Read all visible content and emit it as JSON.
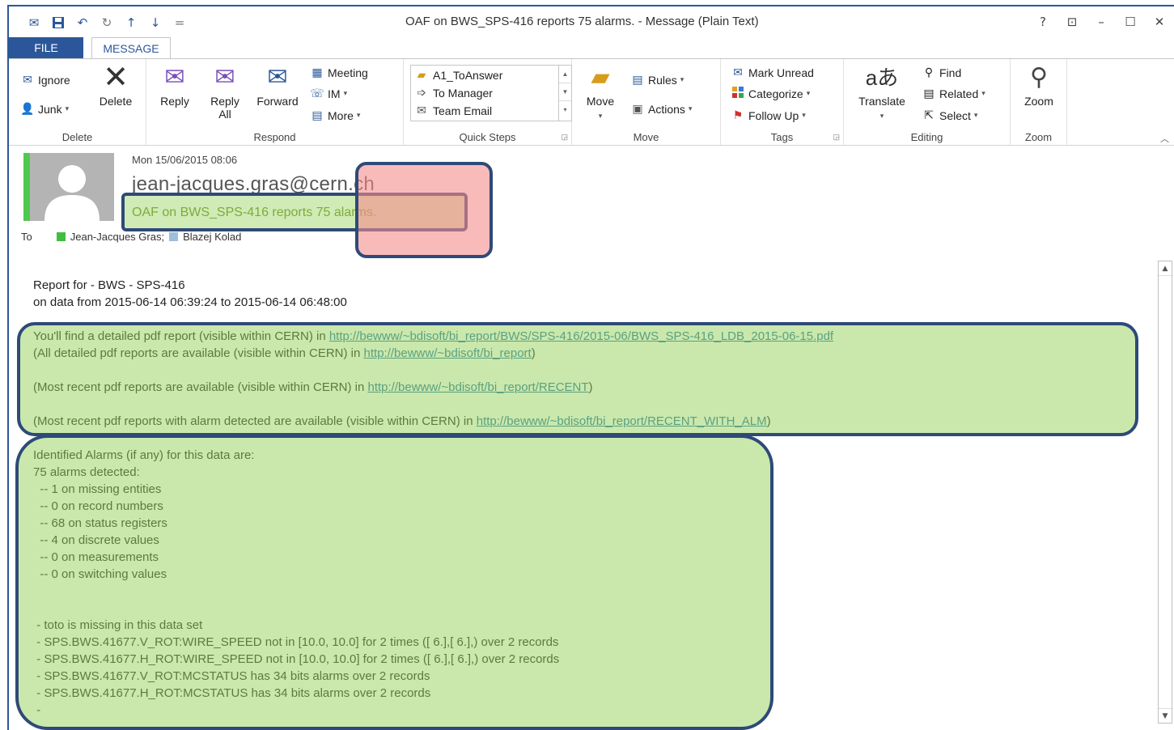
{
  "window": {
    "title": "OAF on BWS_SPS-416 reports 75 alarms. - Message (Plain Text)",
    "controls": {
      "help": "?",
      "ribbon_opts": "⊡",
      "minimize": "–",
      "maximize": "☐",
      "close": "✕"
    }
  },
  "qat": {
    "mail": "✉",
    "save": "💾",
    "undo": "↶",
    "redo": "↻",
    "up": "↑",
    "down": "↓",
    "more": "="
  },
  "tabs": {
    "file": "FILE",
    "message": "MESSAGE"
  },
  "ribbon": {
    "delete_group": {
      "label": "Delete",
      "ignore": "Ignore",
      "junk": "Junk",
      "delete": "Delete"
    },
    "respond_group": {
      "label": "Respond",
      "reply": "Reply",
      "reply_all_1": "Reply",
      "reply_all_2": "All",
      "forward": "Forward",
      "meeting": "Meeting",
      "im": "IM",
      "more": "More"
    },
    "quick_steps": {
      "label": "Quick Steps",
      "items": [
        "A1_ToAnswer",
        "To Manager",
        "Team Email"
      ]
    },
    "move_group": {
      "label": "Move",
      "move": "Move",
      "rules": "Rules",
      "actions": "Actions"
    },
    "tags_group": {
      "label": "Tags",
      "mark_unread": "Mark Unread",
      "categorize": "Categorize",
      "follow_up": "Follow Up"
    },
    "editing_group": {
      "label": "Editing",
      "translate": "Translate",
      "find": "Find",
      "related": "Related",
      "select": "Select"
    },
    "zoom_group": {
      "label": "Zoom",
      "zoom": "Zoom"
    }
  },
  "header": {
    "date": "Mon 15/06/2015 08:06",
    "sender": "jean-jacques.gras@cern.ch",
    "subject": "OAF on BWS_SPS-416 reports 75 alarms.",
    "to_label": "To",
    "recipients": [
      {
        "name": "Jean-Jacques Gras;",
        "color": "#3fbf3f"
      },
      {
        "name": "Blazej Kolad",
        "color": "#9ebfdc"
      }
    ]
  },
  "body": {
    "report_for": "Report for - BWS - SPS-416",
    "data_range": "on data from 2015-06-14 06:39:24 to 2015-06-14 06:48:00",
    "detail_prefix": "You'll find a detailed pdf report (visible within CERN) in ",
    "detail_link": "http://bewww/~bdisoft/bi_report/BWS/SPS-416/2015-06/BWS_SPS-416_LDB_2015-06-15.pdf",
    "all_prefix": "(All detailed pdf reports are available (visible within CERN)  in ",
    "all_link": "http://bewww/~bdisoft/bi_report",
    "all_suffix": ")",
    "recent_prefix": "(Most recent pdf reports are available (visible within CERN)  in ",
    "recent_link": "http://bewww/~bdisoft/bi_report/RECENT",
    "recent_suffix": ")",
    "alm_prefix": "(Most recent pdf reports with alarm detected are available (visible within CERN)  in ",
    "alm_link": "http://bewww/~bdisoft/bi_report/RECENT_WITH_ALM",
    "alm_suffix": ")",
    "alarms_lines": [
      "Identified Alarms (if any) for this data are:",
      "75 alarms detected:",
      "  -- 1 on missing entities",
      "  -- 0 on record numbers",
      "  -- 68 on status registers",
      "  -- 4 on discrete values",
      "  -- 0 on measurements",
      "  -- 0 on switching values"
    ],
    "detail_lines": [
      " - toto is missing in this data set",
      " - SPS.BWS.41677.V_ROT:WIRE_SPEED not in [10.0, 10.0] for 2 times ([ 6.],[ 6.],) over 2 records",
      " - SPS.BWS.41677.H_ROT:WIRE_SPEED not in [10.0, 10.0] for 2 times ([ 6.],[ 6.],) over 2 records",
      " - SPS.BWS.41677.V_ROT:MCSTATUS has 34 bits alarms over 2 records",
      " - SPS.BWS.41677.H_ROT:MCSTATUS has 34 bits alarms over 2 records",
      " -"
    ]
  }
}
